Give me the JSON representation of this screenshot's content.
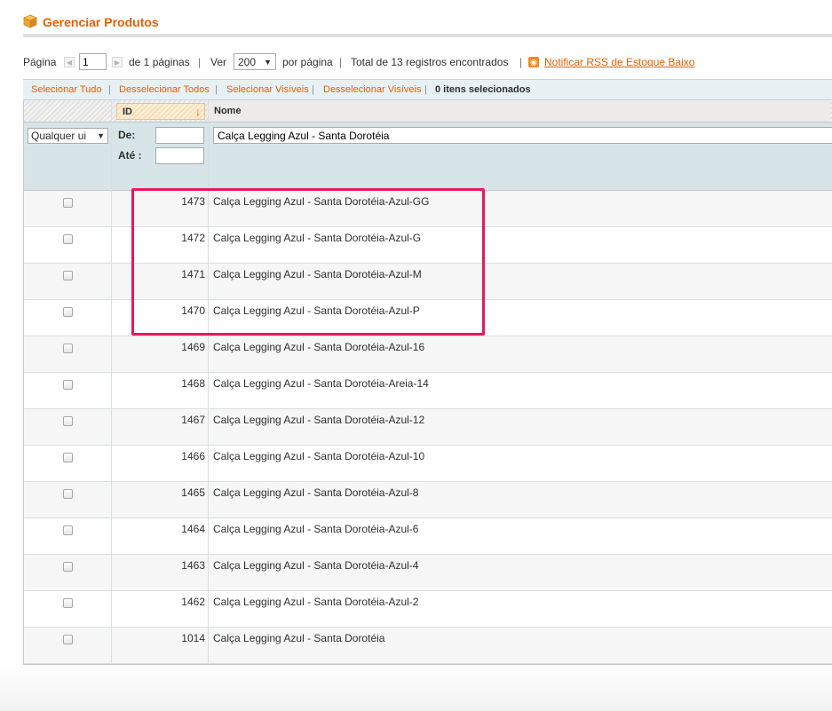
{
  "header": {
    "title": "Gerenciar Produtos",
    "icon": "box-icon"
  },
  "pager": {
    "page_label": "Página",
    "page_value": "1",
    "of_pages": "de 1 páginas",
    "view_label": "Ver",
    "per_page_value": "200",
    "per_page_suffix": "por página",
    "total": "Total de 13 registros encontrados",
    "rss_label": "Notificar RSS de Estoque Baixo",
    "sep": "|"
  },
  "massaction": {
    "select_all": "Selecionar Tudo",
    "unselect_all": "Desselecionar Todos",
    "select_visible": "Selecionar Visíveis",
    "unselect_visible": "Desselecionar Visíveis",
    "selected_count": "0 itens selecionados",
    "sep": "|"
  },
  "grid": {
    "columns": {
      "id": "ID",
      "name": "Nome"
    },
    "filter": {
      "any_select": "Qualquer ui",
      "from_label": "De:",
      "to_label": "Até :",
      "name_value": "Calça Legging Azul - Santa Dorotéia"
    },
    "rows": [
      {
        "id": "1473",
        "name": "Calça Legging Azul - Santa Dorotéia-Azul-GG"
      },
      {
        "id": "1472",
        "name": "Calça Legging Azul - Santa Dorotéia-Azul-G"
      },
      {
        "id": "1471",
        "name": "Calça Legging Azul - Santa Dorotéia-Azul-M"
      },
      {
        "id": "1470",
        "name": "Calça Legging Azul - Santa Dorotéia-Azul-P"
      },
      {
        "id": "1469",
        "name": "Calça Legging Azul - Santa Dorotéia-Azul-16"
      },
      {
        "id": "1468",
        "name": "Calça Legging Azul - Santa Dorotéia-Areia-14"
      },
      {
        "id": "1467",
        "name": "Calça Legging Azul - Santa Dorotéia-Azul-12"
      },
      {
        "id": "1466",
        "name": "Calça Legging Azul - Santa Dorotéia-Azul-10"
      },
      {
        "id": "1465",
        "name": "Calça Legging Azul - Santa Dorotéia-Azul-8"
      },
      {
        "id": "1464",
        "name": "Calça Legging Azul - Santa Dorotéia-Azul-6"
      },
      {
        "id": "1463",
        "name": "Calça Legging Azul - Santa Dorotéia-Azul-4"
      },
      {
        "id": "1462",
        "name": "Calça Legging Azul - Santa Dorotéia-Azul-2"
      },
      {
        "id": "1014",
        "name": "Calça Legging Azul - Santa Dorotéia"
      }
    ]
  },
  "colors": {
    "accent": "#eb5e00",
    "highlight": "#e8185f",
    "filter_bg": "#d7e5e9"
  }
}
